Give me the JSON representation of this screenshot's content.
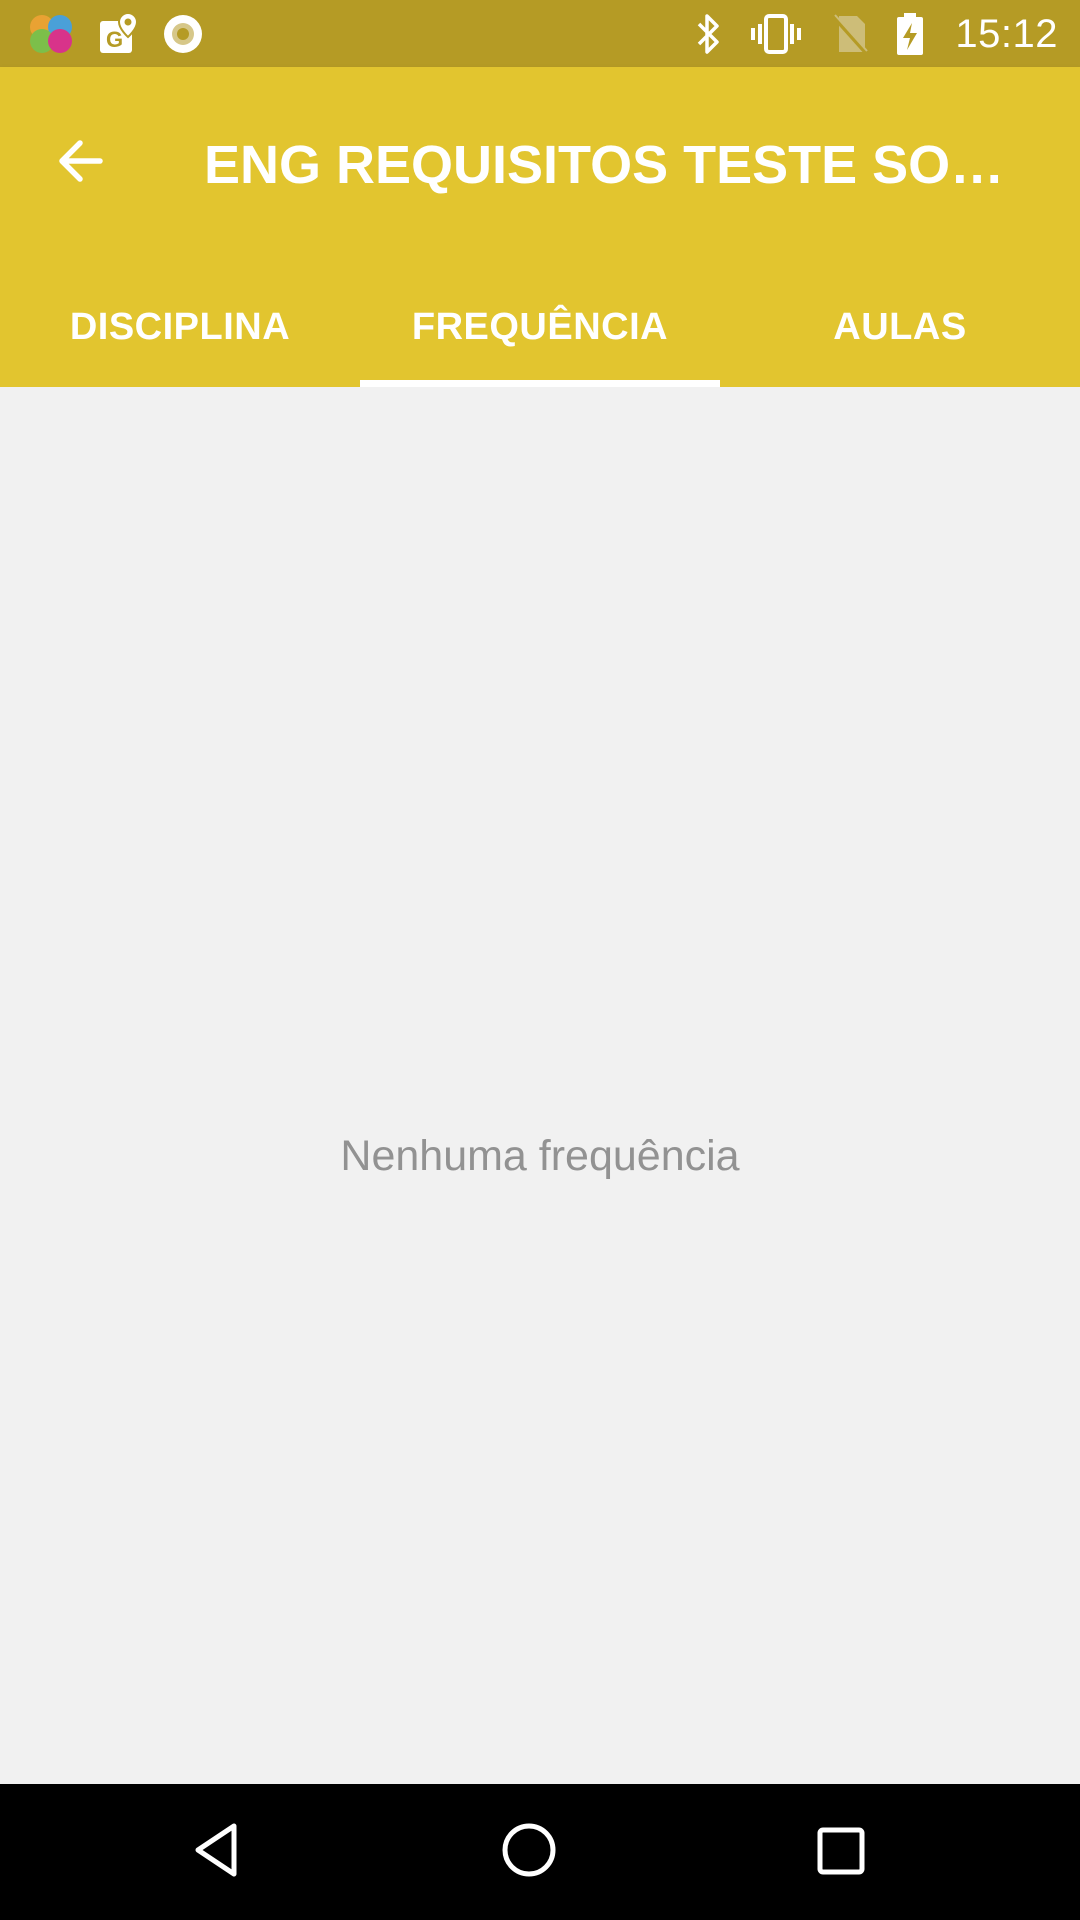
{
  "status_bar": {
    "time": "15:12",
    "left_icons": [
      "puzzle-app-icon",
      "maps-icon",
      "circle-notification-icon"
    ],
    "right_icons": [
      "bluetooth-icon",
      "vibrate-icon",
      "no-sim-icon",
      "battery-charging-icon"
    ],
    "background": "#b59b25"
  },
  "toolbar": {
    "title": "ENG REQUISITOS TESTE SOFTWARE",
    "back_icon": "arrow-back-icon",
    "background": "#e2c52f"
  },
  "tabs": [
    {
      "label": "DISCIPLINA",
      "selected": false
    },
    {
      "label": "FREQUÊNCIA",
      "selected": true
    },
    {
      "label": "AULAS",
      "selected": false
    }
  ],
  "content": {
    "empty_message": "Nenhuma frequência"
  },
  "nav_bar": {
    "buttons": [
      "back-triangle-icon",
      "home-circle-icon",
      "recents-square-icon"
    ]
  }
}
